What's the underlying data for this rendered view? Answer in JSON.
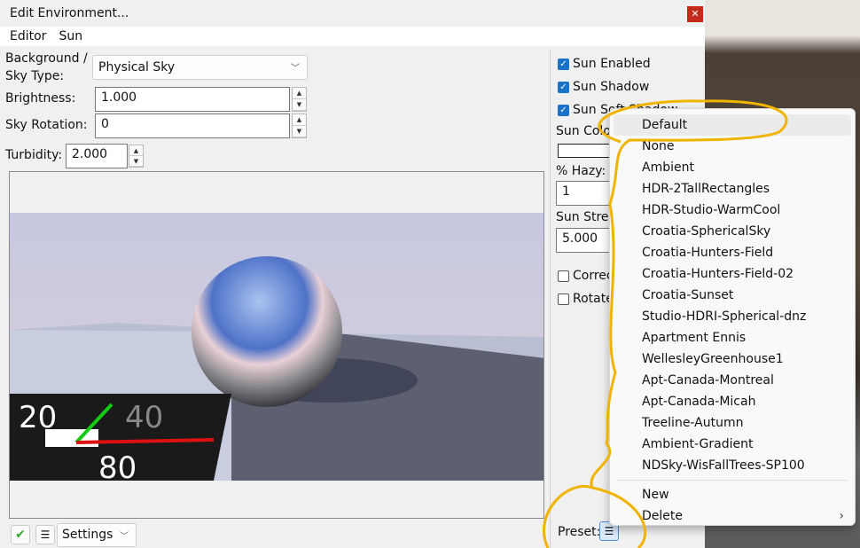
{
  "window": {
    "title": "Edit Environment...",
    "close_icon": "close-icon"
  },
  "menubar": [
    "Editor",
    "Sun"
  ],
  "form": {
    "bg_label_1": "Background /",
    "bg_label_2": "Sky Type:",
    "bg_value": "Physical Sky",
    "brightness_label": "Brightness:",
    "brightness_value": "1.000",
    "rotation_label": "Sky Rotation:",
    "rotation_value": "0",
    "turbidity_label": "Turbidity:",
    "turbidity_value": "2.000"
  },
  "preview": {
    "labels": [
      "20",
      "40",
      "80",
      "20",
      "40",
      "80",
      "80"
    ]
  },
  "sun": {
    "enabled": "Sun Enabled",
    "shadow": "Sun Shadow",
    "soft_shadow": "Sun Soft Shadow",
    "color_label": "Sun Color",
    "hazy_label": "% Hazy:",
    "hazy_value": "1",
    "strength_label": "Sun Strength",
    "strength_value": "5.000",
    "correct_label": "Correct",
    "rotate_label": "Rotate"
  },
  "bottom": {
    "settings": "Settings",
    "preset_label": "Preset:"
  },
  "preset_menu": {
    "items": [
      "Default",
      "None",
      "Ambient",
      "HDR-2TallRectangles",
      "HDR-Studio-WarmCool",
      "Croatia-SphericalSky",
      "Croatia-Hunters-Field",
      "Croatia-Hunters-Field-02",
      "Croatia-Sunset",
      "Studio-HDRI-Spherical-dnz",
      "Apartment Ennis",
      "WellesleyGreenhouse1",
      "Apt-Canada-Montreal",
      "Apt-Canada-Micah",
      "Treeline-Autumn",
      "Ambient-Gradient",
      "NDSky-WisFallTrees-SP100"
    ],
    "new": "New",
    "delete": "Delete"
  },
  "colors": {
    "accent": "#1a73c9",
    "annotation": "#f0b400",
    "close": "#c42b1c"
  }
}
